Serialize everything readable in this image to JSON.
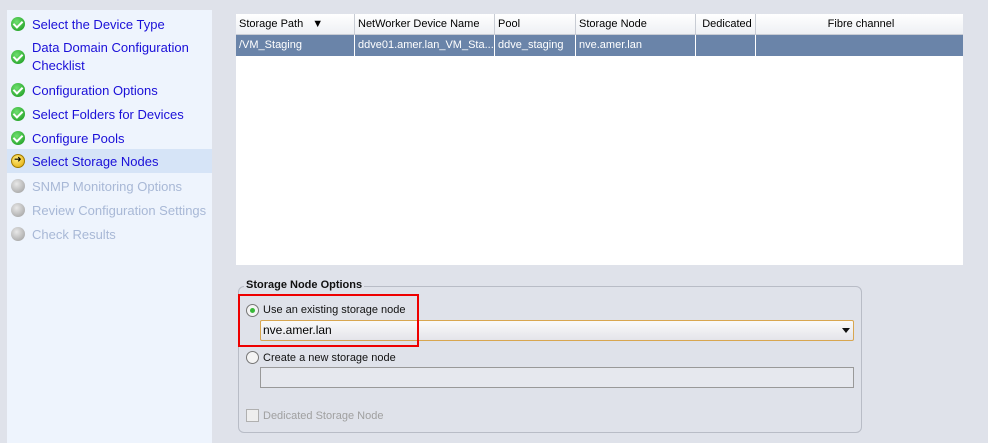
{
  "sidebar": {
    "steps": [
      {
        "label": "Select the Device Type",
        "state": "done"
      },
      {
        "label": "Data Domain Configuration",
        "label2": "Checklist",
        "state": "done"
      },
      {
        "label": "Configuration Options",
        "state": "done"
      },
      {
        "label": "Select Folders for Devices",
        "state": "done"
      },
      {
        "label": "Configure Pools",
        "state": "done"
      },
      {
        "label": "Select Storage Nodes",
        "state": "current"
      },
      {
        "label": "SNMP Monitoring Options",
        "state": "pending"
      },
      {
        "label": "Review Configuration Settings",
        "state": "pending"
      },
      {
        "label": "Check Results",
        "state": "pending"
      }
    ]
  },
  "table": {
    "columns": [
      "Storage Path",
      "NetWorker Device Name",
      "Pool",
      "Storage Node",
      "Dedicated",
      "Fibre channel"
    ],
    "sort_indicator": "▼",
    "rows": [
      [
        "/VM_Staging",
        "ddve01.amer.lan_VM_Sta...",
        "ddve_staging",
        "nve.amer.lan",
        "",
        ""
      ]
    ]
  },
  "options": {
    "title": "Storage Node Options",
    "existing_label": "Use an existing storage node",
    "existing_value": "nve.amer.lan",
    "new_label": "Create a new storage node",
    "new_value": "",
    "dedicated_label": "Dedicated Storage Node"
  }
}
